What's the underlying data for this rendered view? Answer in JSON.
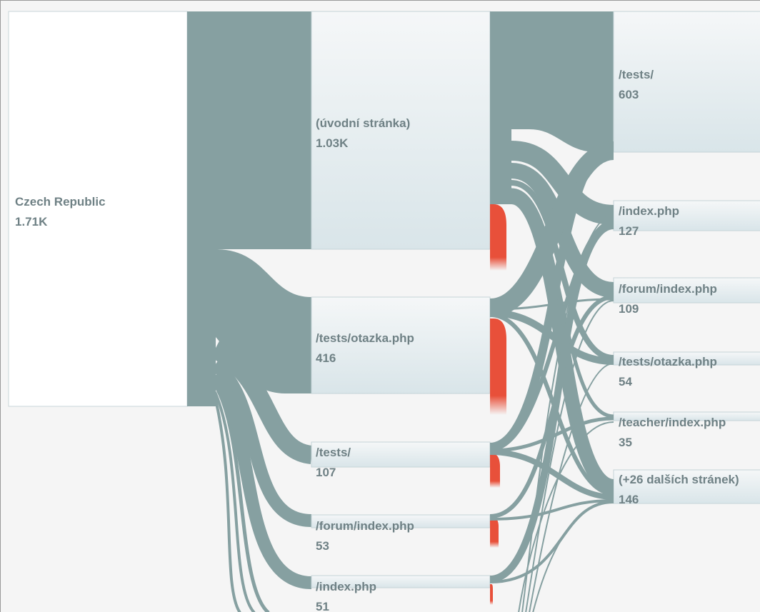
{
  "source": {
    "label": "Czech Republic",
    "value": "1.71K"
  },
  "step1": [
    {
      "label": "(úvodní stránka)",
      "value": "1.03K"
    },
    {
      "label": "/tests/otazka.php",
      "value": "416"
    },
    {
      "label": "/tests/",
      "value": "107"
    },
    {
      "label": "/forum/index.php",
      "value": "53"
    },
    {
      "label": "/index.php",
      "value": "51"
    }
  ],
  "step2": [
    {
      "label": "/tests/",
      "value": "603"
    },
    {
      "label": "/index.php",
      "value": "127"
    },
    {
      "label": "/forum/index.php",
      "value": "109"
    },
    {
      "label": "/tests/otazka.php",
      "value": "54"
    },
    {
      "label": "/teacher/index.php",
      "value": "35"
    },
    {
      "label": "(+26 dalších stránek)",
      "value": "146"
    }
  ],
  "colors": {
    "flow": "#86a0a1",
    "drop_off": "#e8503a",
    "node_top": "#f4f6f7",
    "node_bottom": "#dbe6ea",
    "node_border": "#c5d4d8"
  }
}
